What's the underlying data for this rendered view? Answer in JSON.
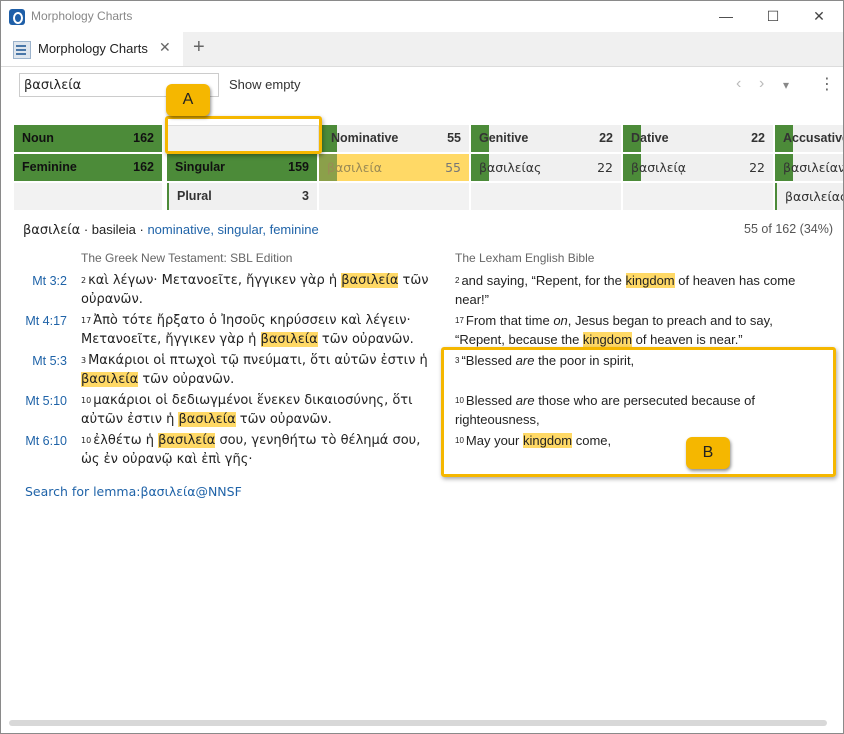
{
  "window": {
    "title": "Morphology Charts",
    "controls": {
      "minimize": "—",
      "maximize": "☐",
      "close": "✕"
    }
  },
  "tabs": [
    {
      "label": "Morphology Charts",
      "close": "✕"
    }
  ],
  "tab_add": "+",
  "toolbar": {
    "search_value": "βασιλεία",
    "show_empty": "Show empty",
    "back": "‹",
    "forward": "›",
    "dropdown": "▾",
    "more": "⋮"
  },
  "grid": {
    "row1": [
      {
        "label": "Noun",
        "count": "162"
      },
      {
        "label": "",
        "count": ""
      },
      {
        "label": "Nominative",
        "count": "55"
      },
      {
        "label": "Genitive",
        "count": "22"
      },
      {
        "label": "Dative",
        "count": "22"
      },
      {
        "label": "Accusative",
        "count": ""
      }
    ],
    "row2": [
      {
        "label": "Feminine",
        "count": "162"
      },
      {
        "label": "Singular",
        "count": "159"
      },
      {
        "label": "βασιλεία",
        "count": "55"
      },
      {
        "label": "βασιλείας",
        "count": "22"
      },
      {
        "label": "βασιλείᾳ",
        "count": "22"
      },
      {
        "label": "βασιλείαν",
        "count": ""
      }
    ],
    "row3": [
      {
        "label": "Plural",
        "count": "3"
      },
      {
        "label": "βασιλείας",
        "count": ""
      }
    ]
  },
  "result": {
    "lemma": "βασιλεία",
    "translit": "basileia",
    "parse": "nominative, singular, feminine",
    "count_text": "55 of 162 (34%)"
  },
  "columns": {
    "left_head": "The Greek New Testament: SBL Edition",
    "right_head": "The Lexham English Bible"
  },
  "verses": [
    {
      "ref": "Mt 3:2",
      "gk_num": "2",
      "gk_pre": "καὶ λέγων· Μετανοεῖτε, ἤγγικεν γὰρ ἡ ",
      "gk_hl": "βασιλεία",
      "gk_post": " τῶν οὐρανῶν.",
      "en_num": "2",
      "en_pre": "and saying, “Repent, for the ",
      "en_hl": "kingdom",
      "en_post": " of heaven has come near!”"
    },
    {
      "ref": "Mt 4:17",
      "gk_num": "17",
      "gk_pre": "Ἀπὸ τότε ἤρξατο ὁ Ἰησοῦς κηρύσσειν καὶ λέγειν· Μετανοεῖτε, ἤγγικεν γὰρ ἡ ",
      "gk_hl": "βασιλεία",
      "gk_post": " τῶν οὐρανῶν.",
      "en_num": "17",
      "en_pre": "From that time ",
      "en_em": "on",
      "en_mid": ", Jesus began to preach and to say, “Repent, because the ",
      "en_hl": "kingdom",
      "en_post": " of heaven is near.”"
    },
    {
      "ref": "Mt 5:3",
      "gk_num": "3",
      "gk_pre": "Μακάριοι οἱ πτωχοὶ τῷ πνεύματι, ὅτι αὐτῶν ἐστιν ἡ ",
      "gk_hl": "βασιλεία",
      "gk_post": " τῶν οὐρανῶν.",
      "en_num": "3",
      "en_pre": "“Blessed ",
      "en_em": "are",
      "en_mid": " the poor in spirit,",
      "en_hl": "",
      "en_post": ""
    },
    {
      "ref": "Mt 5:10",
      "gk_num": "10",
      "gk_pre": "μακάριοι οἱ δεδιωγμένοι ἕνεκεν δικαιοσύνης, ὅτι αὐτῶν ἐστιν ἡ ",
      "gk_hl": "βασιλεία",
      "gk_post": " τῶν οὐρανῶν.",
      "en_num": "10",
      "en_pre": "Blessed ",
      "en_em": "are",
      "en_mid": " those who are persecuted because of righteousness,",
      "en_hl": "",
      "en_post": ""
    },
    {
      "ref": "Mt 6:10",
      "gk_num": "10",
      "gk_pre": "ἐλθέτω ἡ ",
      "gk_hl": "βασιλεία",
      "gk_post": " σου, γενηθήτω τὸ θέλημά σου, ὡς ἐν οὐρανῷ καὶ ἐπὶ γῆς·",
      "en_num": "10",
      "en_pre": "May your ",
      "en_hl": "kingdom",
      "en_post": " come,"
    }
  ],
  "search_link": "Search for lemma:βασιλεία@NNSF",
  "callouts": {
    "a": "A",
    "b": "B"
  },
  "colors": {
    "green": "#4c8b39",
    "highlight": "#ffd966",
    "callout": "#f5b700",
    "link": "#1f63a8"
  }
}
